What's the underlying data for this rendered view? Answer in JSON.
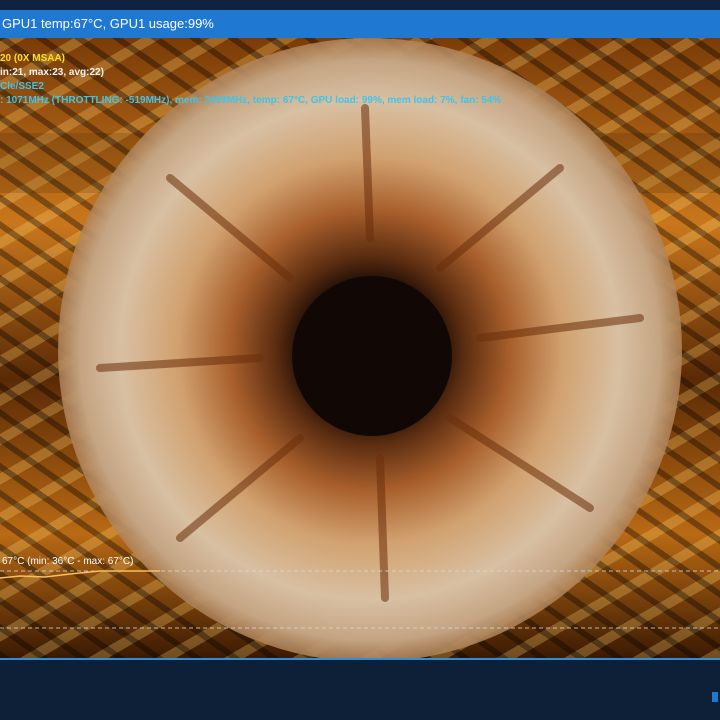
{
  "window": {
    "title": "GPU1 temp:67°C, GPU1 usage:99%"
  },
  "hud": {
    "line1": "20 (0X MSAA)",
    "line2": "in:21, max:23, avg:22)",
    "line3": "Cle/SSE2",
    "line4": ": 1071MHz (THROTTLING: -519MHz), mem: 2499MHz, temp: 67°C, GPU load: 99%, mem load: 7%, fan: 54%"
  },
  "temp_graph": {
    "label": "67°C (min: 36°C - max: 67°C)"
  },
  "colors": {
    "title_bar": "#1f78d1",
    "hud_yellow": "#f6e21a",
    "hud_cyan": "#41c4e6",
    "bottom_panel": "#0e2037"
  }
}
